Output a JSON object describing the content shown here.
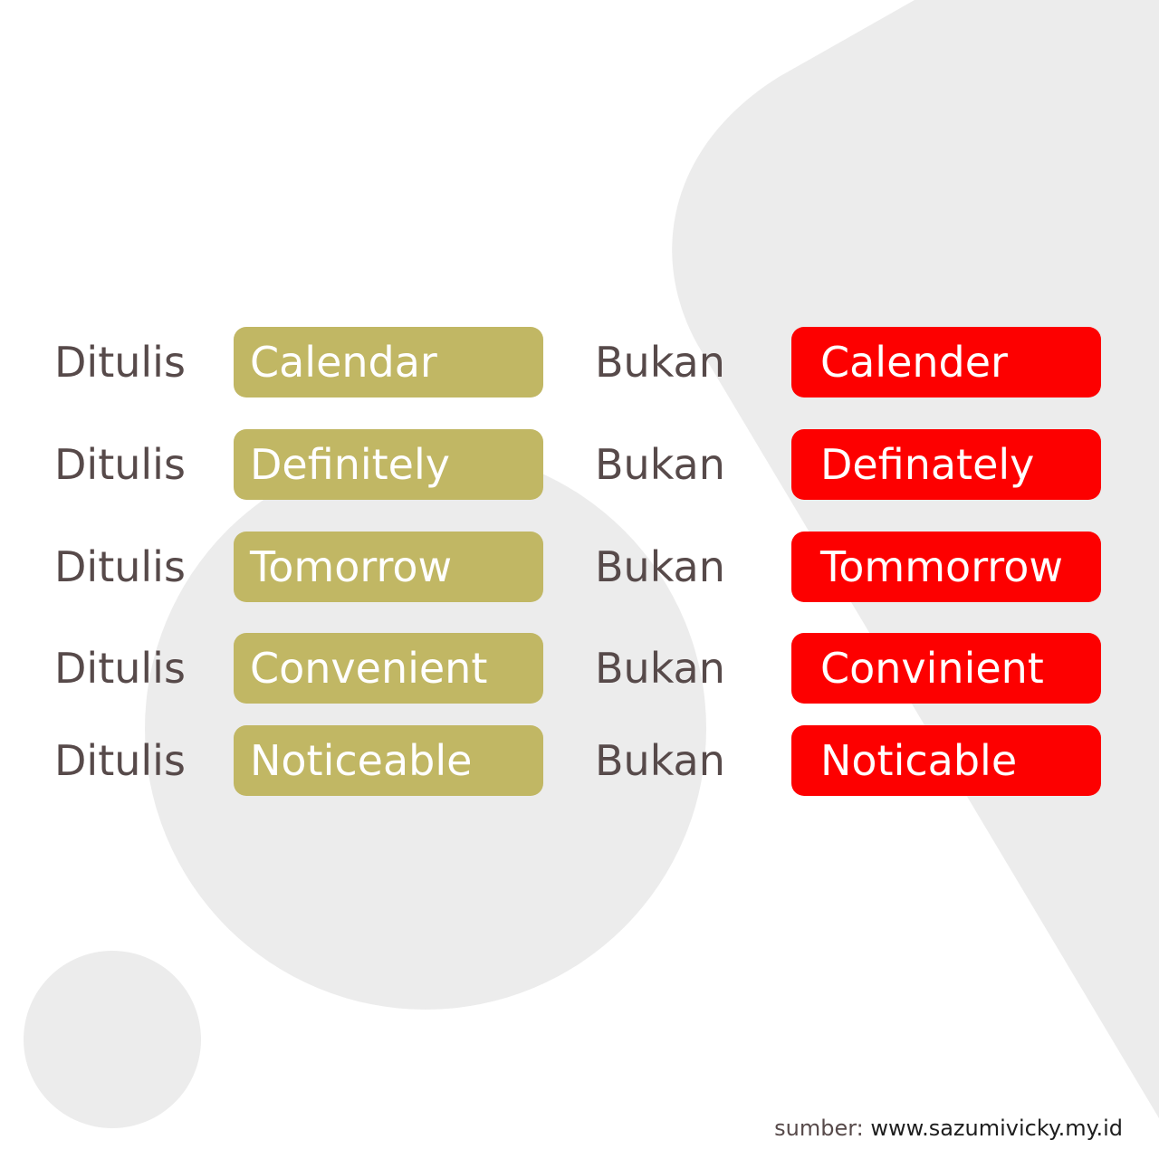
{
  "colors": {
    "background": "#ffffff",
    "shape": "#ececec",
    "text": "#574a4a",
    "correct_pill": "#c1b764",
    "wrong_pill": "#fd0000"
  },
  "correct_label": "Ditulis",
  "wrong_label": "Bukan",
  "rows": [
    {
      "correct": "Calendar",
      "wrong": "Calender"
    },
    {
      "correct": "Definitely",
      "wrong": "Definately"
    },
    {
      "correct": "Tomorrow",
      "wrong": "Tommorrow"
    },
    {
      "correct": "Convenient",
      "wrong": "Convinient"
    },
    {
      "correct": "Noticeable",
      "wrong": "Noticable"
    }
  ],
  "source": {
    "prefix": "sumber: ",
    "site": "www.sazumivicky.my.id"
  }
}
